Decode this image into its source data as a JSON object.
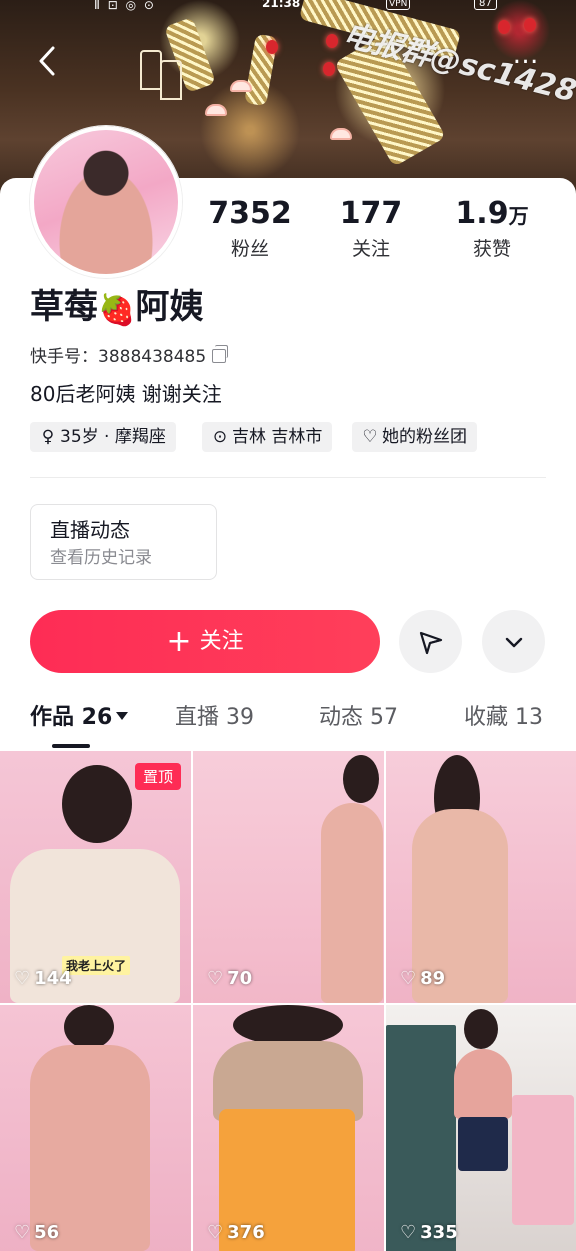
{
  "status_bar": {
    "time": "21:38",
    "signal": "Ⅱ  ⊡ ◎ ⊙",
    "vpn": "VPN",
    "battery": "87"
  },
  "header": {
    "back_icon": "back-arrow-icon",
    "more_label": "…",
    "watermark": "电报群@sc1428"
  },
  "profile": {
    "name": "草莓",
    "name_emoji": "🍓",
    "name_suffix": "阿姨",
    "kuaishou_id": "快手号：3888438485",
    "bio": "80后老阿姨 谢谢关注",
    "stats": [
      {
        "value": "7352",
        "unit": "",
        "label": "粉丝"
      },
      {
        "value": "177",
        "unit": "",
        "label": "关注"
      },
      {
        "value": "1.9",
        "unit": "万",
        "label": "获赞"
      }
    ],
    "tags": [
      {
        "icon": "gender-icon",
        "glyph": "♀",
        "text": "35岁 · 摩羯座"
      },
      {
        "icon": "location-icon",
        "glyph": "⊙",
        "text": "吉林 吉林市"
      },
      {
        "icon": "fan-group-icon",
        "glyph": "♡",
        "text": "她的粉丝团"
      }
    ]
  },
  "live_box": {
    "title": "直播动态",
    "subtitle": "查看历史记录"
  },
  "actions": {
    "follow_label": "关注",
    "follow_plus": "+",
    "share_glyph": "◁",
    "more_glyph": "⌄"
  },
  "tabs": [
    {
      "label": "作品 26",
      "active": true
    },
    {
      "label": "直播 39",
      "active": false
    },
    {
      "label": "动态 57",
      "active": false
    },
    {
      "label": "收藏 13",
      "active": false
    }
  ],
  "videos": [
    {
      "likes": "144",
      "pinned": "置顶",
      "caption": "我老上火了"
    },
    {
      "likes": "70"
    },
    {
      "likes": "89"
    },
    {
      "likes": "56"
    },
    {
      "likes": "376"
    },
    {
      "likes": "335"
    }
  ],
  "colors": {
    "accent": "#fe2c55",
    "text": "#161823",
    "muted": "#8a8b91",
    "chip_bg": "#f1f1f2"
  }
}
